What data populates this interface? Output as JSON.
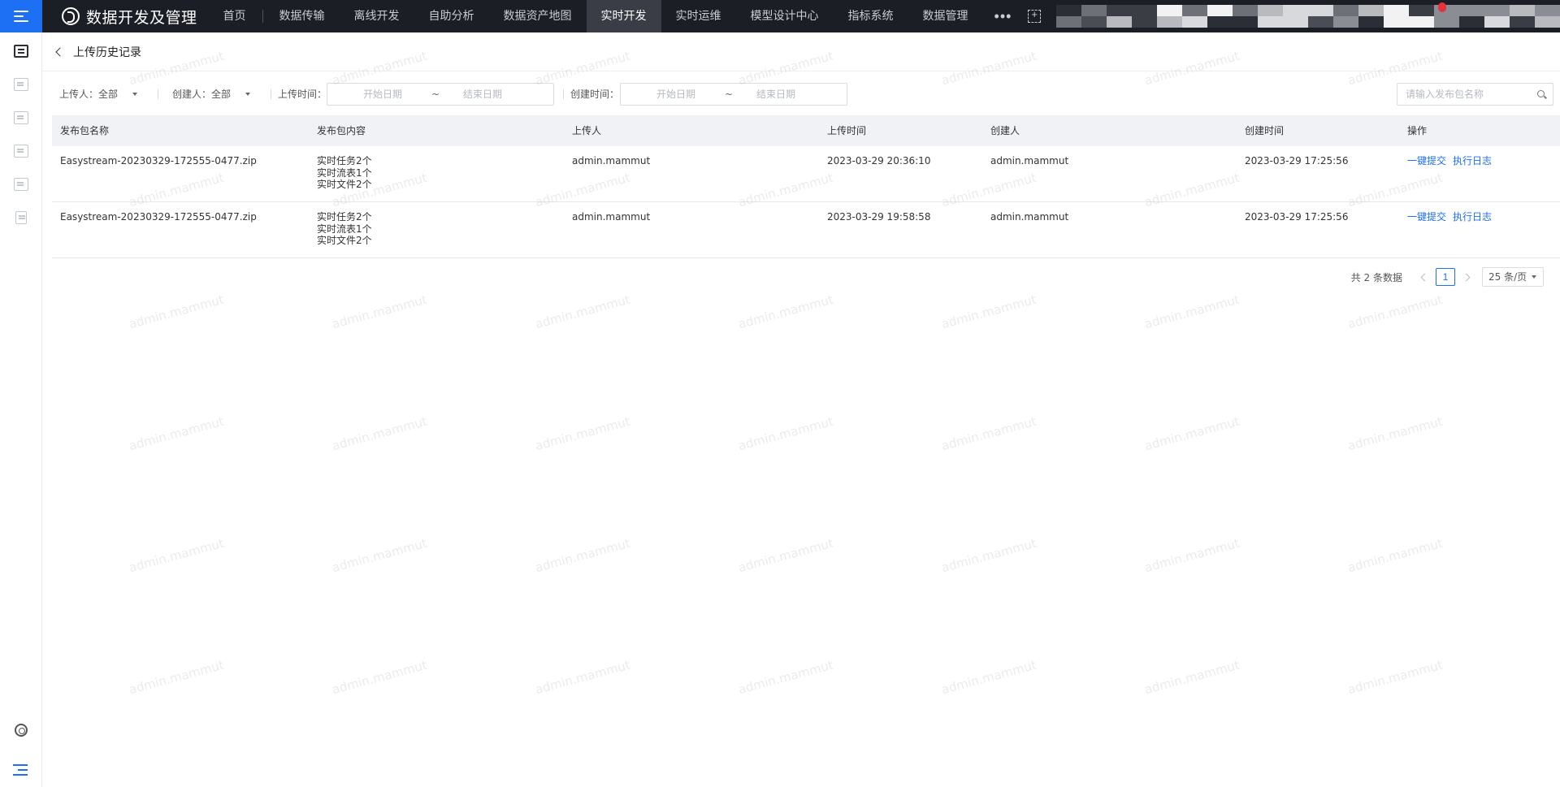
{
  "topbar": {
    "brand": "数据开发及管理",
    "nav": [
      {
        "label": "首页"
      },
      {
        "label": "数据传输"
      },
      {
        "label": "离线开发"
      },
      {
        "label": "自助分析"
      },
      {
        "label": "数据资产地图"
      },
      {
        "label": "实时开发",
        "active": true
      },
      {
        "label": "实时运维"
      },
      {
        "label": "模型设计中心"
      },
      {
        "label": "指标系统"
      },
      {
        "label": "数据管理"
      }
    ],
    "more": "•••",
    "icons": {
      "menu": "menu-icon",
      "fullscreen": "fullscreen-icon"
    },
    "accent_color": "#1d6ff3",
    "bar_color": "#1b1e25"
  },
  "page": {
    "title": "上传历史记录"
  },
  "filters": {
    "uploader": "上传人：全部",
    "creator": "创建人：全部",
    "upload_time_label": "上传时间：",
    "create_time_label": "创建时间：",
    "start_placeholder": "开始日期",
    "end_placeholder": "结束日期",
    "range_sep": "~",
    "search_placeholder": "请输入发布包名称"
  },
  "table": {
    "columns": [
      "发布包名称",
      "发布包内容",
      "上传人",
      "上传时间",
      "创建人",
      "创建时间",
      "操作"
    ],
    "rows": [
      {
        "name": "Easystream-20230329-172555-0477.zip",
        "content": [
          "实时任务2个",
          "实时流表1个",
          "实时文件2个"
        ],
        "uploader": "admin.mammut",
        "upload_time": "2023-03-29 20:36:10",
        "creator": "admin.mammut",
        "create_time": "2023-03-29 17:25:56",
        "actions": [
          "一键提交",
          "执行日志"
        ]
      },
      {
        "name": "Easystream-20230329-172555-0477.zip",
        "content": [
          "实时任务2个",
          "实时流表1个",
          "实时文件2个"
        ],
        "uploader": "admin.mammut",
        "upload_time": "2023-03-29 19:58:58",
        "creator": "admin.mammut",
        "create_time": "2023-03-29 17:25:56",
        "actions": [
          "一键提交",
          "执行日志"
        ]
      }
    ]
  },
  "pagination": {
    "total": "共 2 条数据",
    "current": "1",
    "page_size": "25 条/页"
  },
  "watermark": "admin.mammut"
}
